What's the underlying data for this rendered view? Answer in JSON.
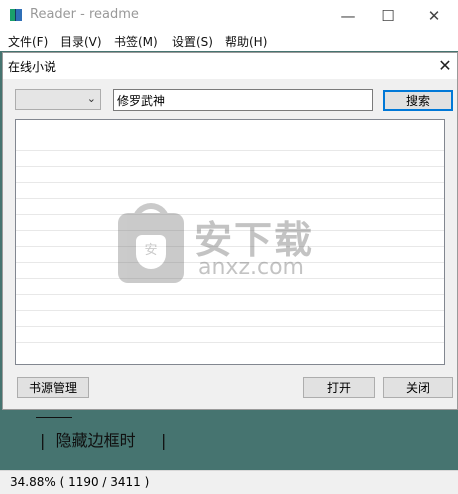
{
  "window": {
    "title": "Reader - readme",
    "min_glyph": "—",
    "max_glyph": "☐",
    "close_glyph": "✕"
  },
  "menu": {
    "items": [
      "文件(F)",
      "目录(V)",
      "书签(M)",
      "设置(S)",
      "帮助(H)"
    ]
  },
  "reader": {
    "visible_text": "|  隐藏边框时     |"
  },
  "status": {
    "text": "34.88%  ( 1190 / 3411 )"
  },
  "dialog": {
    "title": "在线小说",
    "close_glyph": "✕",
    "source_select": {
      "selected": "",
      "chevron": "⌄"
    },
    "search": {
      "value": "修罗武神",
      "button_label": "搜索"
    },
    "results": [],
    "buttons": {
      "manage_sources": "书源管理",
      "open": "打开",
      "close": "关闭"
    }
  },
  "watermark": {
    "cn": "安下载",
    "en": "anxz.com",
    "bag_glyph": "安"
  },
  "colors": {
    "reader_bg": "#467470",
    "accent": "#0078d7"
  }
}
